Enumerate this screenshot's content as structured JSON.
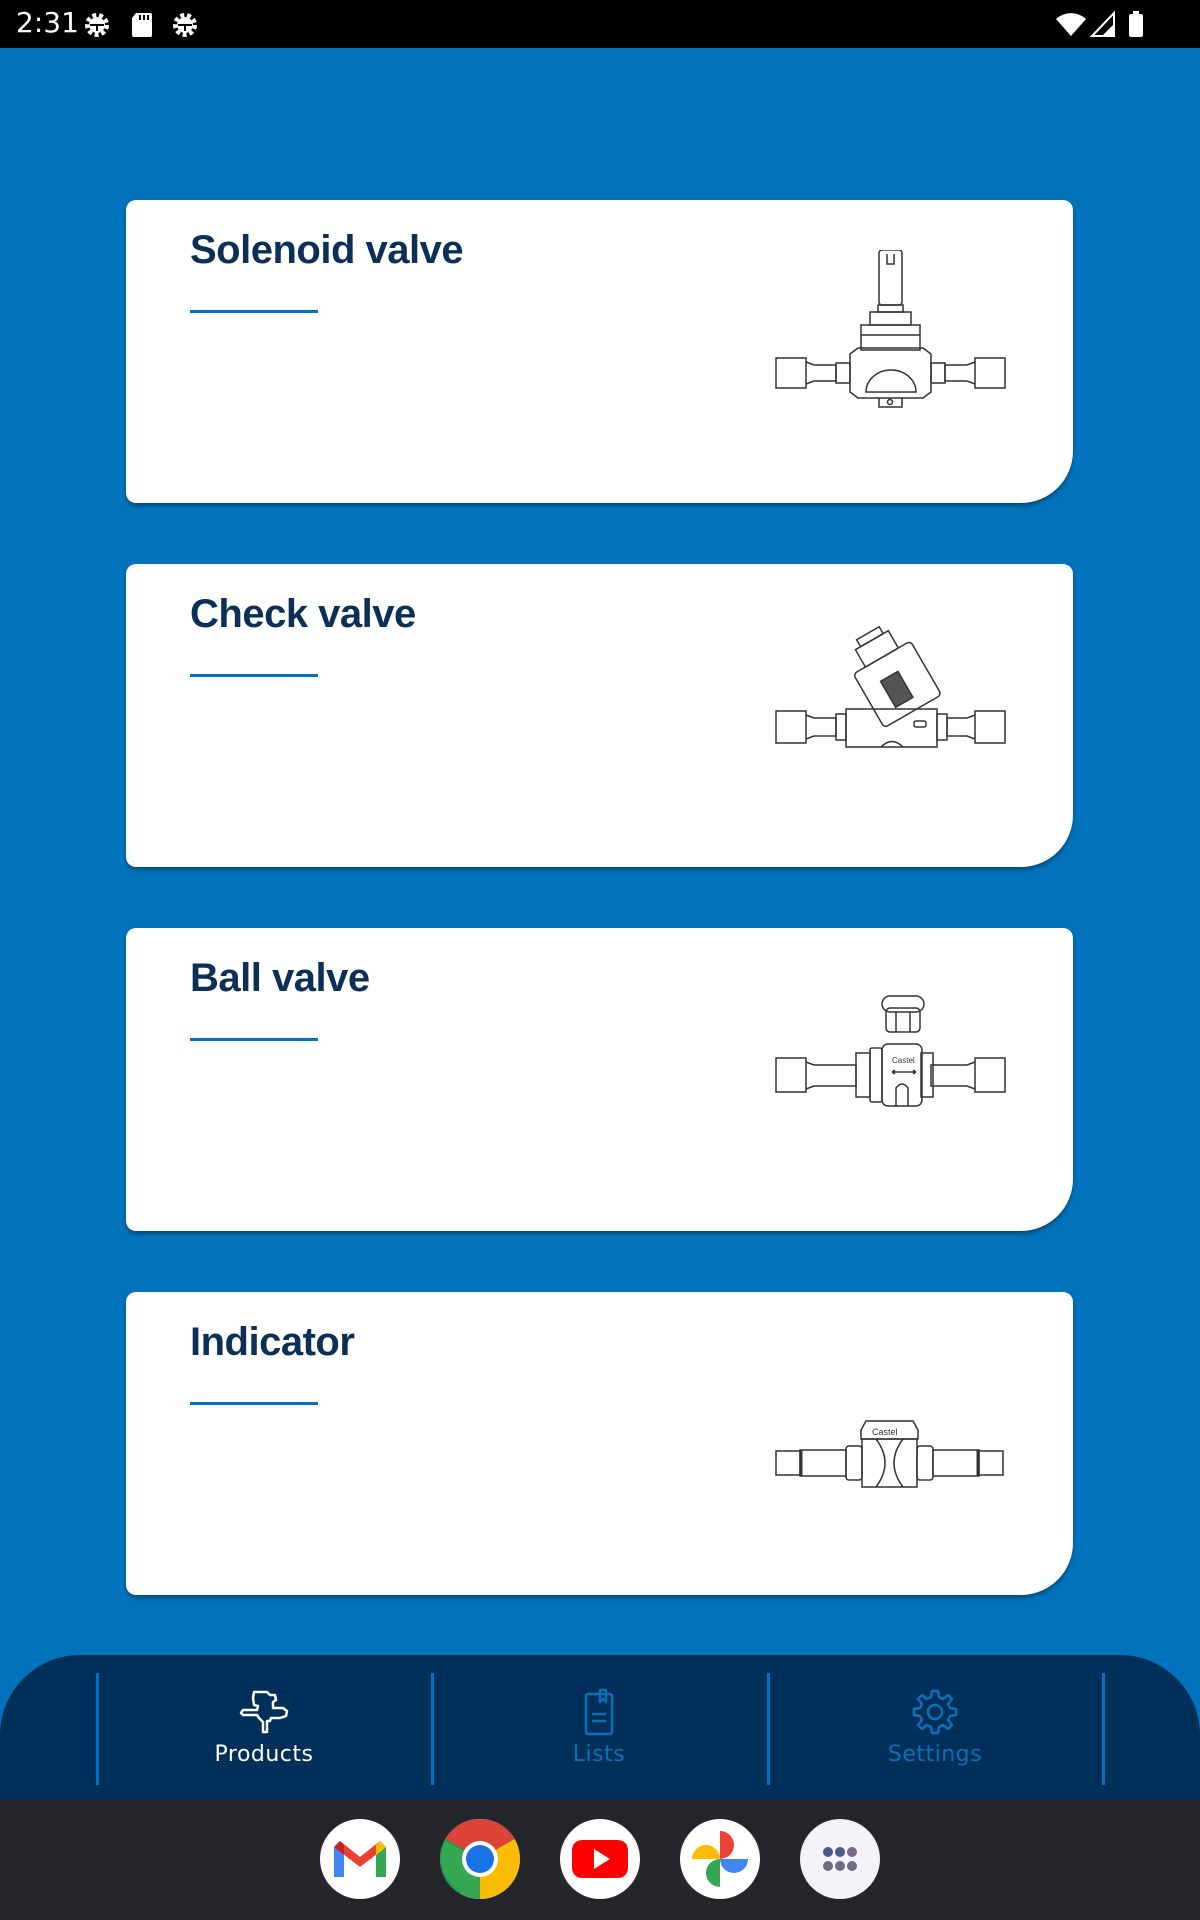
{
  "status_bar": {
    "time": "2:31",
    "left_icons": [
      "settings-gear-icon",
      "sd-card-icon",
      "settings-gear-icon"
    ],
    "right_icons": [
      "wifi-icon",
      "cellular-signal-icon",
      "battery-icon"
    ]
  },
  "products": [
    {
      "title": "Solenoid valve",
      "image": "solenoid-valve-illustration"
    },
    {
      "title": "Check valve",
      "image": "check-valve-illustration"
    },
    {
      "title": "Ball valve",
      "image": "ball-valve-illustration"
    },
    {
      "title": "Indicator",
      "image": "indicator-illustration"
    }
  ],
  "bottom_nav": {
    "items": [
      {
        "label": "Products",
        "icon": "valve-icon",
        "active": true
      },
      {
        "label": "Lists",
        "icon": "clipboard-list-icon",
        "active": false
      },
      {
        "label": "Settings",
        "icon": "gear-icon",
        "active": false
      }
    ],
    "active_color": "#FFFFFF",
    "inactive_color": "#0A6FB5"
  },
  "dock": {
    "apps": [
      "Gmail",
      "Chrome",
      "YouTube",
      "Photos",
      "App drawer"
    ]
  },
  "colors": {
    "background": "#0173BC",
    "card": "#FFFFFF",
    "title": "#0B2F57",
    "nav_background": "#002F5A",
    "dock_background": "#25262B"
  }
}
